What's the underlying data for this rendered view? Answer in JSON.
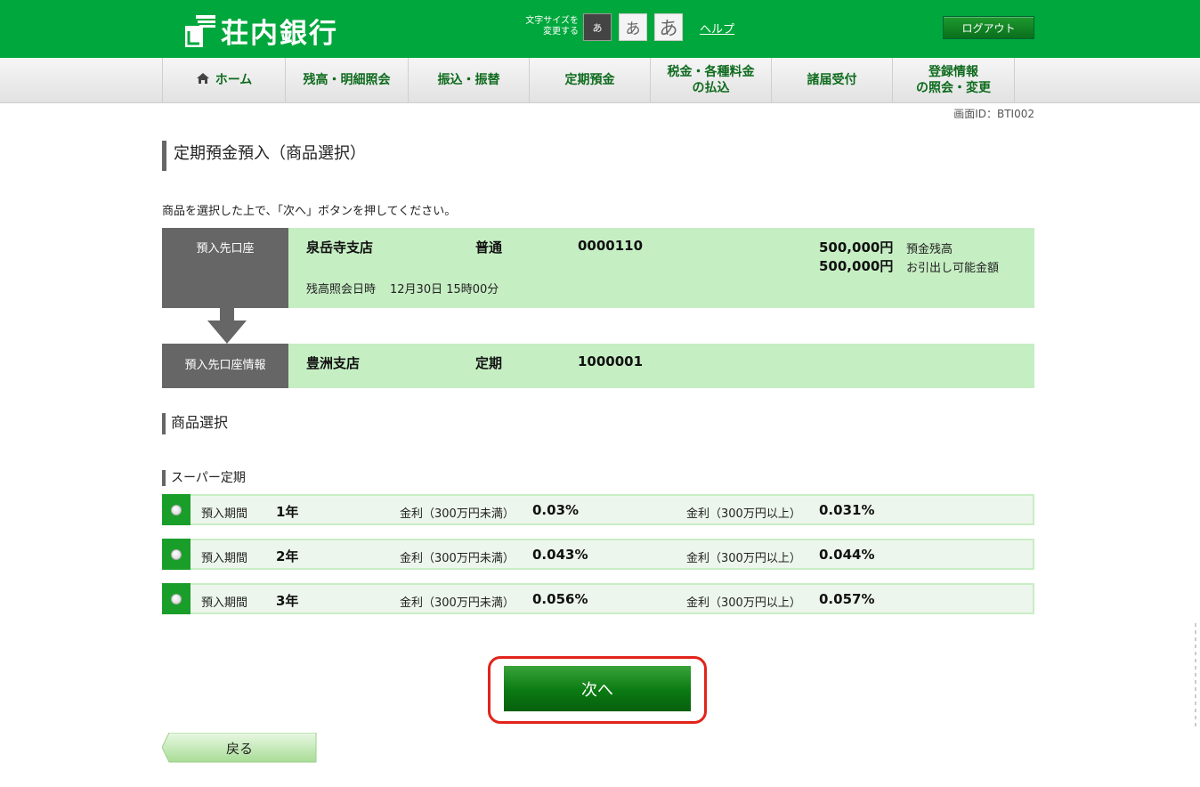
{
  "header": {
    "brand": "荘内銀行",
    "font_size_label_line1": "文字サイズを",
    "font_size_label_line2": "変更する",
    "font_sizes": [
      "あ",
      "あ",
      "あ"
    ],
    "help": "ヘルプ",
    "logout": "ログアウト"
  },
  "nav": {
    "items": [
      {
        "label": "ホーム",
        "icon": "home-icon"
      },
      {
        "label": "残高・明細照会"
      },
      {
        "label": "振込・振替"
      },
      {
        "label": "定期預金"
      },
      {
        "label_line1": "税金・各種料金",
        "label_line2": "の払込"
      },
      {
        "label": "諸届受付"
      },
      {
        "label_line1": "登録情報",
        "label_line2": "の照会・変更"
      }
    ]
  },
  "screen_id": "画面ID：BTI002",
  "page_title": "定期預金預入（商品選択）",
  "instruction": "商品を選択した上で、「次へ」ボタンを押してください。",
  "source_account": {
    "label": "預入先口座",
    "branch": "泉岳寺支店",
    "type": "普通",
    "number": "0000110",
    "balance": "500,000円",
    "balance_label": "預金残高",
    "available": "500,000円",
    "available_label": "お引出し可能金額",
    "inquiry_label": "残高照会日時",
    "inquiry_datetime": "12月30日 15時00分"
  },
  "dest_account": {
    "label": "預入先口座情報",
    "branch": "豊洲支店",
    "type": "定期",
    "number": "1000001"
  },
  "product_section": "商品選択",
  "product_name": "スーパー定期",
  "products": [
    {
      "period_label": "預入期間",
      "period": "1年",
      "rate_low_label": "金利（300万円未満）",
      "rate_low": "0.03%",
      "rate_high_label": "金利（300万円以上）",
      "rate_high": "0.031%"
    },
    {
      "period_label": "預入期間",
      "period": "2年",
      "rate_low_label": "金利（300万円未満）",
      "rate_low": "0.043%",
      "rate_high_label": "金利（300万円以上）",
      "rate_high": "0.044%"
    },
    {
      "period_label": "預入期間",
      "period": "3年",
      "rate_low_label": "金利（300万円未満）",
      "rate_low": "0.056%",
      "rate_high_label": "金利（300万円以上）",
      "rate_high": "0.057%"
    }
  ],
  "next_button": "次へ",
  "back_button": "戻る",
  "colors": {
    "brand_green": "#00a73c",
    "account_bg": "#c6eec3",
    "highlight_red": "#e2231a"
  }
}
